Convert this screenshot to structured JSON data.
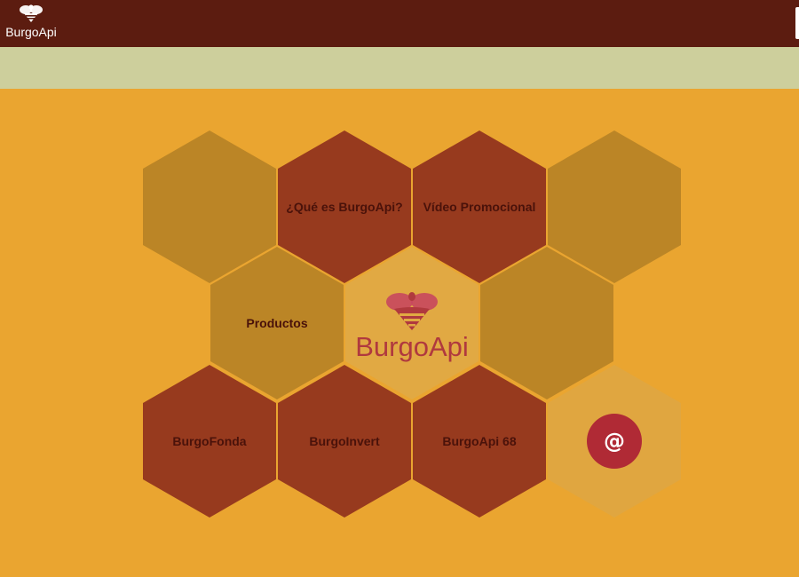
{
  "header": {
    "brand_text": "BurgoApi",
    "logo_icon": "bee-icon"
  },
  "honeycomb": {
    "que_es": "¿Qué es BurgoApi?",
    "video": "Vídeo Promocional",
    "productos": "Productos",
    "center_logo_text": "BurgoApi",
    "burgofonda": "BurgoFonda",
    "burgoinvert": "BurgoInvert",
    "burgoapi68": "BurgoApi 68",
    "contact_symbol": "@"
  },
  "colors": {
    "topbar": "#5c1c10",
    "subbar": "#cdcf9c",
    "background": "#eaa530",
    "hex_olive": "#bb8526",
    "hex_rust": "#973a1e",
    "hex_light": "#e0a640",
    "label_text": "#4a120a",
    "logo_accent": "#b0393e",
    "contact_circle": "#b02a35"
  }
}
